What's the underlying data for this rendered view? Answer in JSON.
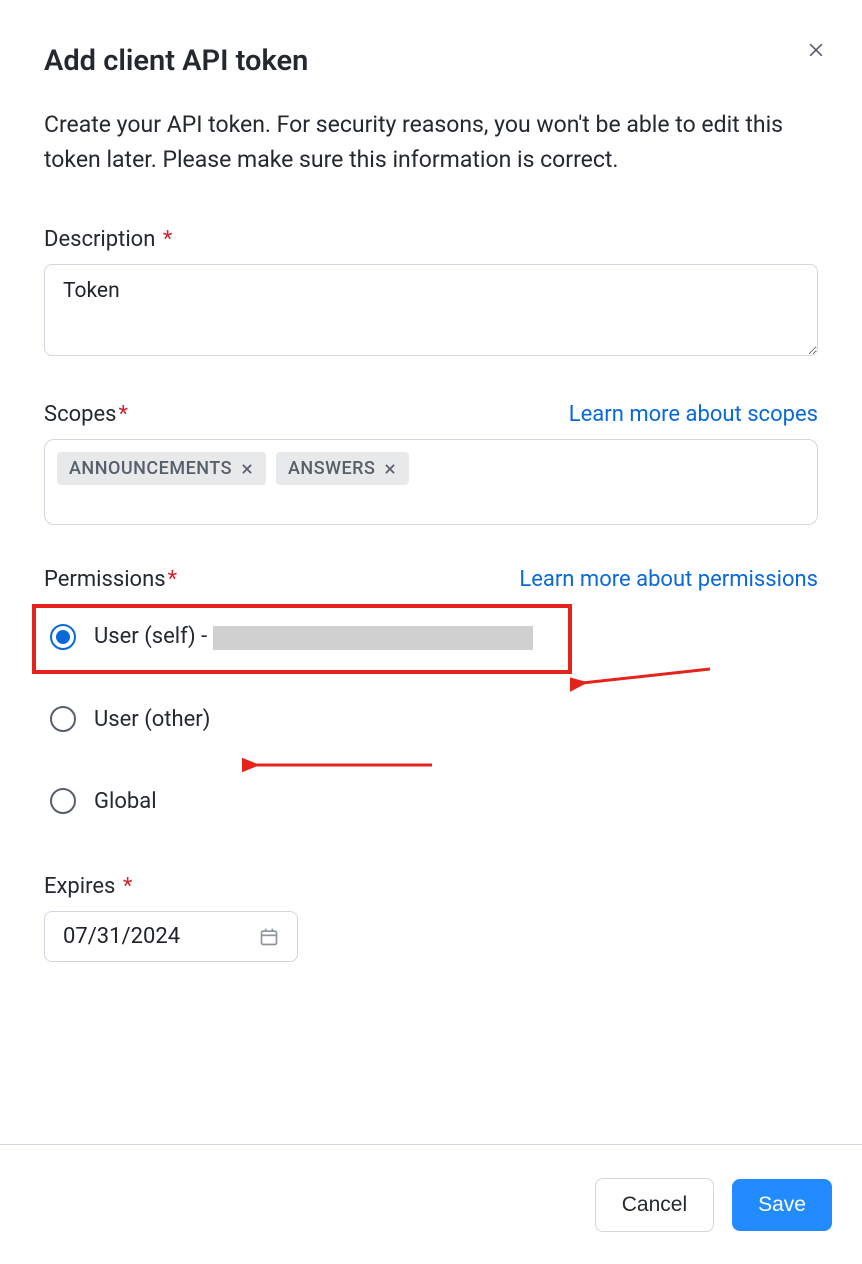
{
  "modal": {
    "title": "Add client API token",
    "subtitle": "Create your API token. For security reasons, you won't be able to edit this token later. Please make sure this information is correct."
  },
  "description": {
    "label": "Description",
    "value": "Token"
  },
  "scopes": {
    "label": "Scopes",
    "learn_more": "Learn more about scopes",
    "tags": [
      {
        "label": "ANNOUNCEMENTS"
      },
      {
        "label": "ANSWERS"
      }
    ]
  },
  "permissions": {
    "label": "Permissions",
    "learn_more": "Learn more about permissions",
    "options": {
      "user_self_prefix": "User (self) - ",
      "user_other": "User (other)",
      "global": "Global"
    }
  },
  "expires": {
    "label": "Expires",
    "value": "07/31/2024"
  },
  "footer": {
    "cancel": "Cancel",
    "save": "Save"
  }
}
